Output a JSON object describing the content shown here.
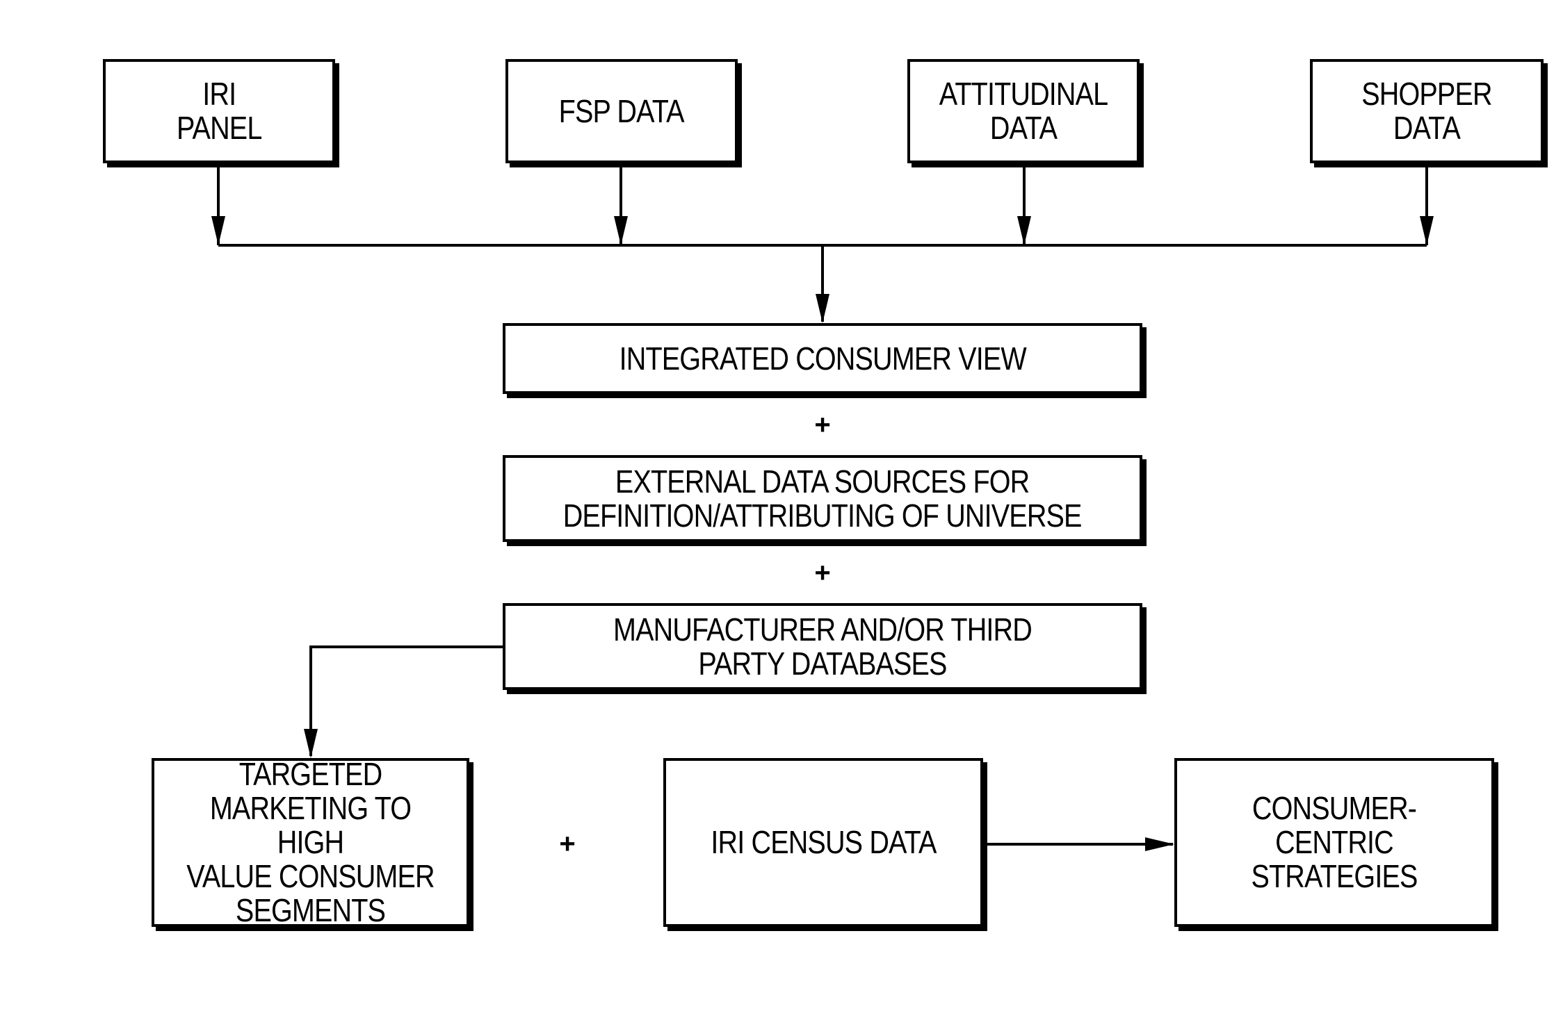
{
  "diagram": {
    "sources": [
      {
        "id": "iri-panel",
        "label": "IRI\nPANEL"
      },
      {
        "id": "fsp-data",
        "label": "FSP DATA"
      },
      {
        "id": "attitudinal-data",
        "label": "ATTITUDINAL\nDATA"
      },
      {
        "id": "shopper-data",
        "label": "SHOPPER\nDATA"
      }
    ],
    "integrated": {
      "label": "INTEGRATED CONSUMER VIEW"
    },
    "external": {
      "label": "EXTERNAL DATA SOURCES FOR\nDEFINITION/ATTRIBUTING OF UNIVERSE"
    },
    "manufacturer": {
      "label": "MANUFACTURER AND/OR THIRD\nPARTY DATABASES"
    },
    "targeted": {
      "label": "TARGETED\nMARKETING TO HIGH\nVALUE CONSUMER\nSEGMENTS"
    },
    "census": {
      "label": "IRI CENSUS DATA"
    },
    "strategies": {
      "label": "CONSUMER-CENTRIC\nSTRATEGIES"
    },
    "plus_symbol": "+",
    "edges": [
      {
        "from": "iri-panel",
        "to": "bus"
      },
      {
        "from": "fsp-data",
        "to": "bus"
      },
      {
        "from": "attitudinal-data",
        "to": "bus"
      },
      {
        "from": "shopper-data",
        "to": "bus"
      },
      {
        "from": "bus",
        "to": "integrated"
      },
      {
        "from": "manufacturer",
        "to": "targeted"
      },
      {
        "from": "census",
        "to": "strategies"
      }
    ]
  }
}
